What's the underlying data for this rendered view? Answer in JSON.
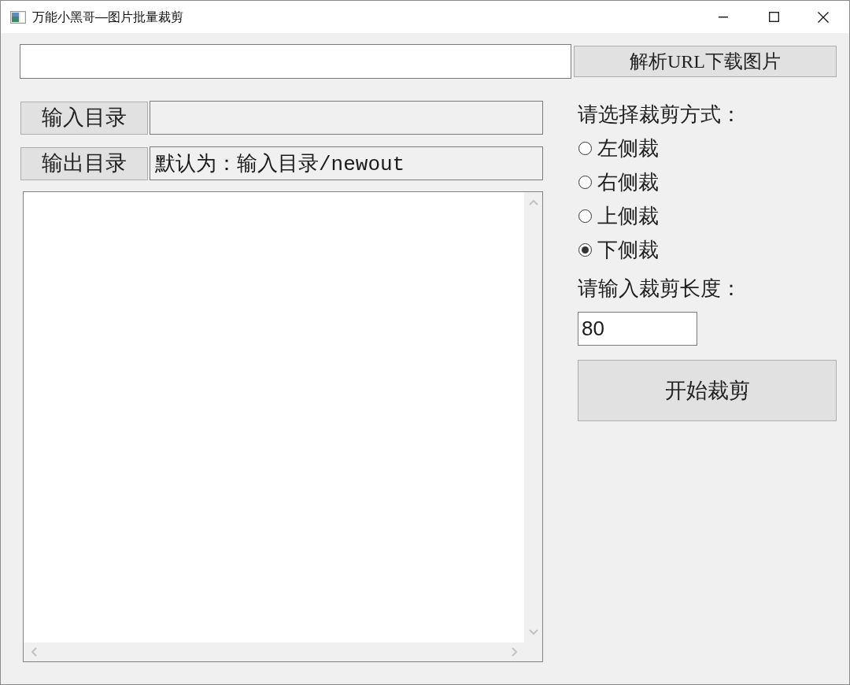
{
  "window": {
    "title": "万能小黑哥—图片批量裁剪"
  },
  "url_row": {
    "button": "解析URL下载图片"
  },
  "input_dir": {
    "button": "输入目录"
  },
  "output_dir": {
    "button": "输出目录",
    "value": "默认为：输入目录/newout"
  },
  "crop_mode": {
    "label": "请选择裁剪方式：",
    "options": [
      {
        "label": "左侧裁",
        "selected": false
      },
      {
        "label": "右侧裁",
        "selected": false
      },
      {
        "label": "上侧裁",
        "selected": false
      },
      {
        "label": "下侧裁",
        "selected": true
      }
    ]
  },
  "crop_length": {
    "label": "请输入裁剪长度：",
    "value": "80"
  },
  "start_button": "开始裁剪"
}
